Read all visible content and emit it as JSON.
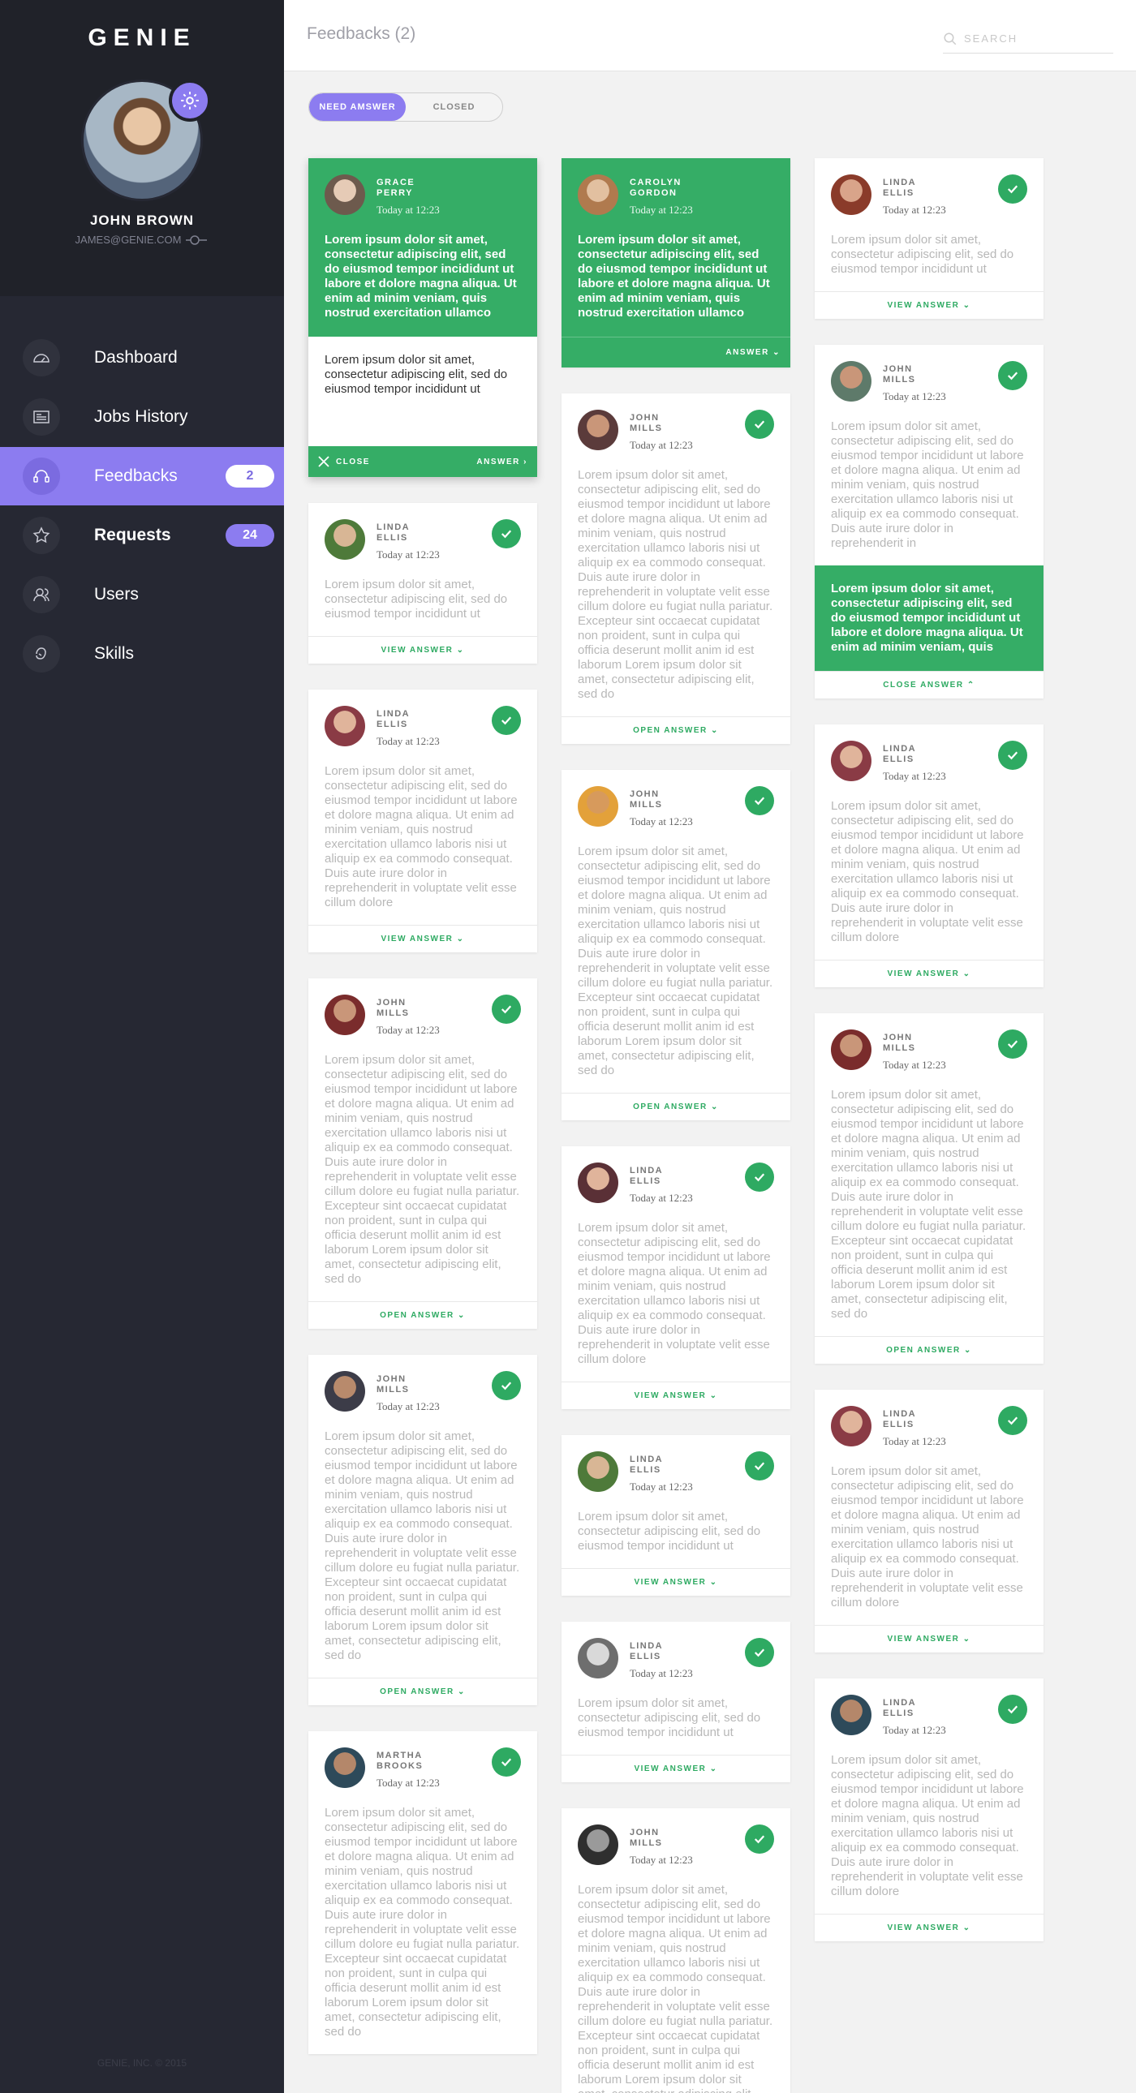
{
  "app": {
    "logo": "GENIE",
    "footer": "GENIE, INC. © 2015"
  },
  "user": {
    "name": "JOHN BROWN",
    "email": "JAMES@GENIE.COM"
  },
  "nav": [
    {
      "label": "Dashboard",
      "icon": "speedometer-icon"
    },
    {
      "label": "Jobs History",
      "icon": "newspaper-icon"
    },
    {
      "label": "Feedbacks",
      "icon": "headset-icon",
      "badge": "2",
      "active": true
    },
    {
      "label": "Requests",
      "icon": "star-icon",
      "badge": "24"
    },
    {
      "label": "Users",
      "icon": "users-icon"
    },
    {
      "label": "Skills",
      "icon": "hand-icon"
    }
  ],
  "header": {
    "title": "Feedbacks (2)",
    "search_placeholder": "SEARCH"
  },
  "filter": {
    "on": "NEED AMSWER",
    "off": "CLOSED"
  },
  "common": {
    "date": "Today at 12:23"
  },
  "text": {
    "short": "Lorem ipsum dolor sit amet, consectetur adipiscing elit, sed do eiusmod tempor incididunt ut",
    "question": "Lorem ipsum dolor sit amet, consectetur adipiscing elit, sed do eiusmod tempor incididunt ut labore et dolore magna aliqua. Ut enim ad minim veniam, quis nostrud exercitation ullamco",
    "medium": "Lorem ipsum dolor sit amet, consectetur adipiscing elit, sed do eiusmod tempor incididunt ut labore et dolore magna aliqua. Ut enim ad minim veniam, quis nostrud exercitation ullamco laboris nisi ut aliquip ex ea commodo consequat. Duis aute irure dolor in reprehenderit in voluptate velit esse cillum dolore",
    "long": "Lorem ipsum dolor sit amet, consectetur adipiscing elit, sed do eiusmod tempor incididunt ut labore et dolore magna aliqua. Ut enim ad minim veniam, quis nostrud exercitation ullamco laboris nisi ut aliquip ex ea commodo consequat. Duis aute irure dolor in reprehenderit in voluptate velit esse cillum dolore eu fugiat nulla pariatur. Excepteur sint occaecat cupidatat non proident, sunt in culpa qui officia deserunt mollit anim id est laborum Lorem ipsum dolor sit amet, consectetur adipiscing elit, sed do",
    "partial": "Lorem ipsum dolor sit amet, consectetur adipiscing elit, sed do eiusmod tempor incididunt ut labore et dolore magna aliqua. Ut enim ad minim veniam, quis nostrud exercitation ullamco laboris nisi ut aliquip ex ea commodo consequat. Duis aute irure dolor in reprehenderit in",
    "answer_short": "Lorem ipsum dolor sit amet, consectetur adipiscing elit, sed do eiusmod tempor incididunt ut",
    "answer_expanded": "Lorem ipsum dolor sit amet, consectetur adipiscing elit, sed do eiusmod tempor incididunt ut labore et dolore magna aliqua. Ut enim ad minim veniam, quis"
  },
  "actions": {
    "view": "VIEW ANSWER",
    "open": "OPEN ANSWER",
    "close_answer": "CLOSE ANSWER",
    "close": "CLOSE",
    "answer": "ANSWER"
  },
  "names": {
    "grace": "GRACE PERRY",
    "carolyn": "CAROLYN GORDON",
    "linda": "LINDA ELLIS",
    "john": "JOHN MILLS",
    "martha": "MARTHA BROOKS"
  },
  "colors": {
    "accent": "#8c7cf0",
    "green": "#2eaa62",
    "sidebar": "#262833"
  }
}
